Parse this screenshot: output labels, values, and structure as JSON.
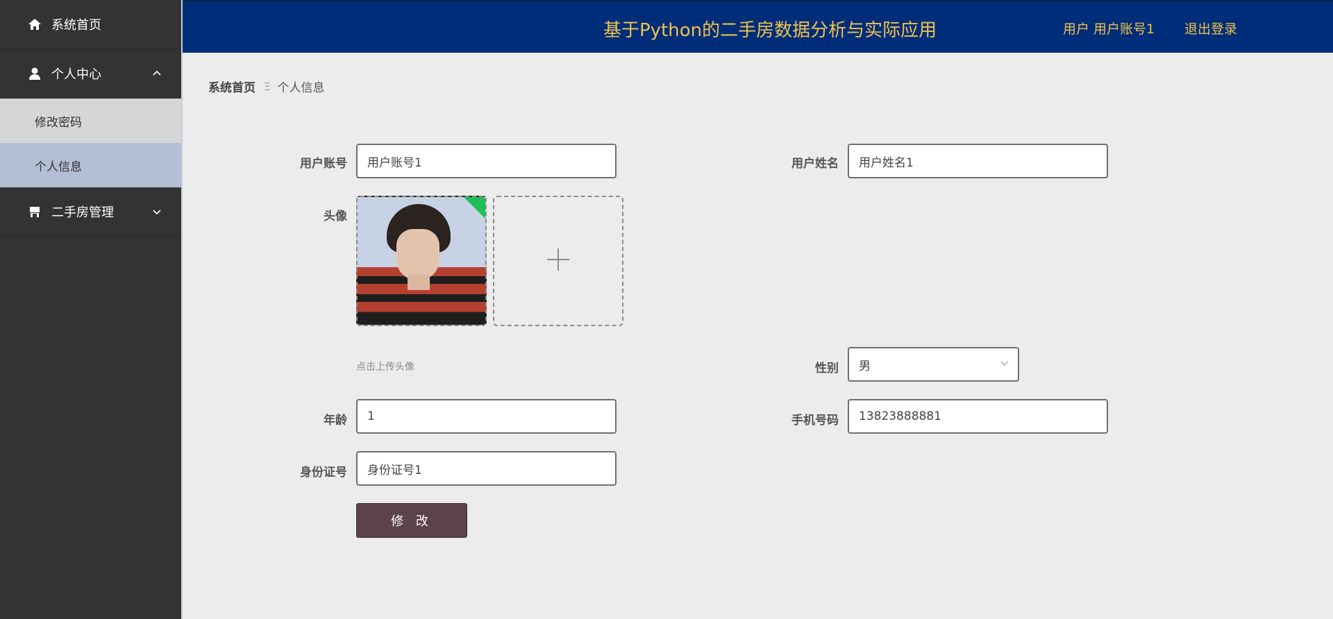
{
  "sidebar": {
    "home": {
      "label": "系统首页",
      "icon": "home-icon"
    },
    "personal_center": {
      "label": "个人中心",
      "icon": "user-icon",
      "expanded": true
    },
    "sub_items": [
      {
        "label": "修改密码"
      },
      {
        "label": "个人信息",
        "active": true
      }
    ],
    "house_manage": {
      "label": "二手房管理",
      "icon": "shop-icon",
      "expanded": false
    }
  },
  "header": {
    "title": "基于Python的二手房数据分析与实际应用",
    "user": "用户  用户账号1",
    "logout": "退出登录"
  },
  "breadcrumb": {
    "home": "系统首页",
    "separator": "Ξ",
    "current": "个人信息"
  },
  "form": {
    "account": {
      "label": "用户账号",
      "value": "用户账号1"
    },
    "name": {
      "label": "用户姓名",
      "value": "用户姓名1"
    },
    "avatar": {
      "label": "头像",
      "hint": "点击上传头像"
    },
    "gender": {
      "label": "性别",
      "value": "男"
    },
    "age": {
      "label": "年龄",
      "value": "1"
    },
    "phone": {
      "label": "手机号码",
      "value": "13823888881"
    },
    "id_card": {
      "label": "身份证号",
      "value": "身份证号1"
    },
    "submit": "修 改"
  },
  "colors": {
    "sidebar_bg": "#333333",
    "header_bg": "#002d7a",
    "header_text": "#f0c24b",
    "active_sub": "#b4bfd6",
    "submit_bg": "#5c434b"
  }
}
